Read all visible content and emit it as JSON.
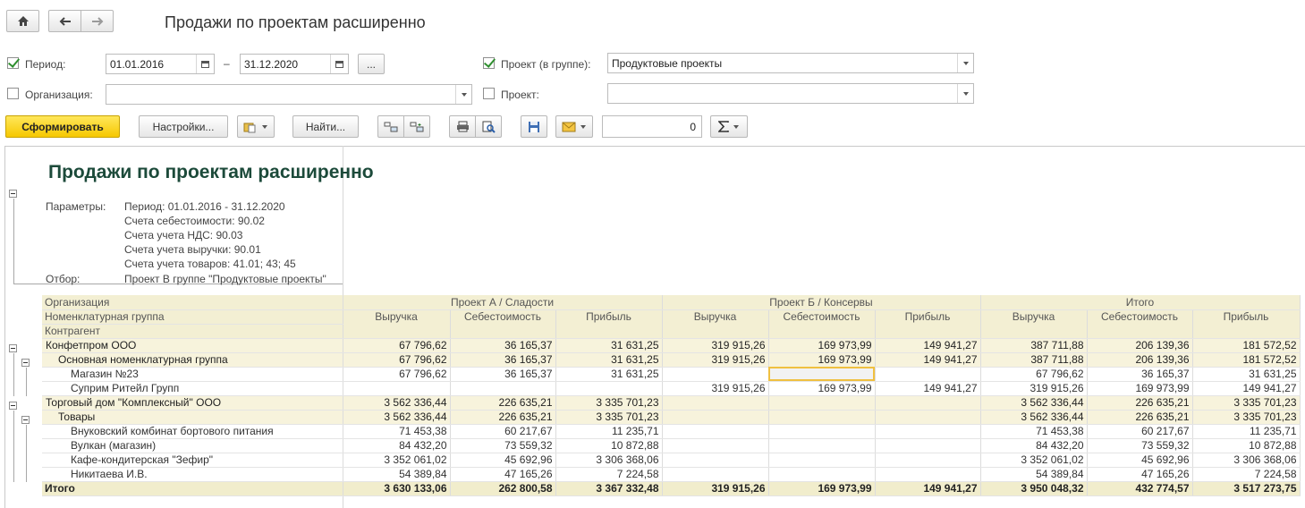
{
  "window": {
    "title": "Продажи по проектам расширенно"
  },
  "filters": {
    "period_label": "Период:",
    "period_from": "01.01.2016",
    "period_dash": "–",
    "period_to": "31.12.2020",
    "period_more": "...",
    "org_label": "Организация:",
    "org_value": "",
    "project_group_label": "Проект (в группе):",
    "project_group_value": "Продуктовые проекты",
    "project_label": "Проект:",
    "project_value": ""
  },
  "toolbar": {
    "generate": "Сформировать",
    "settings": "Настройки...",
    "find": "Найти...",
    "sum_field": "0"
  },
  "report": {
    "title": "Продажи по проектам расширенно",
    "params_label": "Параметры:",
    "params": [
      "Период: 01.01.2016 - 31.12.2020",
      "Счета себестоимости: 90.02",
      "Счета учета НДС: 90.03",
      "Счета учета выручки: 90.01",
      "Счета учета товаров: 41.01; 43; 45"
    ],
    "filter_label": "Отбор:",
    "filter_value": "Проект В группе \"Продуктовые проекты\""
  },
  "table": {
    "row_headers": [
      "Организация",
      "Номенклатурная группа",
      "Контрагент"
    ],
    "groups": [
      "Проект А / Сладости",
      "Проект Б / Консервы",
      "Итого"
    ],
    "columns": [
      "Выручка",
      "Себестоимость",
      "Прибыль",
      "Выручка",
      "Себестоимость",
      "Прибыль",
      "Выручка",
      "Себестоимость",
      "Прибыль"
    ],
    "rows": [
      {
        "level": 0,
        "name": "Конфетпром ООО",
        "values": [
          "67 796,62",
          "36 165,37",
          "31 631,25",
          "319 915,26",
          "169 973,99",
          "149 941,27",
          "387 711,88",
          "206 139,36",
          "181 572,52"
        ]
      },
      {
        "level": 1,
        "name": "Основная номенклатурная группа",
        "values": [
          "67 796,62",
          "36 165,37",
          "31 631,25",
          "319 915,26",
          "169 973,99",
          "149 941,27",
          "387 711,88",
          "206 139,36",
          "181 572,52"
        ]
      },
      {
        "level": 2,
        "name": "Магазин №23",
        "values": [
          "67 796,62",
          "36 165,37",
          "31 631,25",
          "",
          "",
          "",
          "67 796,62",
          "36 165,37",
          "31 631,25"
        ]
      },
      {
        "level": 2,
        "name": "Суприм Ритейл Групп",
        "values": [
          "",
          "",
          "",
          "319 915,26",
          "169 973,99",
          "149 941,27",
          "319 915,26",
          "169 973,99",
          "149 941,27"
        ]
      },
      {
        "level": 0,
        "name": "Торговый дом \"Комплексный\" ООО",
        "values": [
          "3 562 336,44",
          "226 635,21",
          "3 335 701,23",
          "",
          "",
          "",
          "3 562 336,44",
          "226 635,21",
          "3 335 701,23"
        ]
      },
      {
        "level": 1,
        "name": "Товары",
        "values": [
          "3 562 336,44",
          "226 635,21",
          "3 335 701,23",
          "",
          "",
          "",
          "3 562 336,44",
          "226 635,21",
          "3 335 701,23"
        ]
      },
      {
        "level": 2,
        "name": "Внуковский комбинат бортового питания",
        "values": [
          "71 453,38",
          "60 217,67",
          "11 235,71",
          "",
          "",
          "",
          "71 453,38",
          "60 217,67",
          "11 235,71"
        ]
      },
      {
        "level": 2,
        "name": "Вулкан (магазин)",
        "values": [
          "84 432,20",
          "73 559,32",
          "10 872,88",
          "",
          "",
          "",
          "84 432,20",
          "73 559,32",
          "10 872,88"
        ]
      },
      {
        "level": 2,
        "name": "Кафе-кондитерская \"Зефир\"",
        "values": [
          "3 352 061,02",
          "45 692,96",
          "3 306 368,06",
          "",
          "",
          "",
          "3 352 061,02",
          "45 692,96",
          "3 306 368,06"
        ]
      },
      {
        "level": 2,
        "name": "Никитаева И.В.",
        "values": [
          "54 389,84",
          "47 165,26",
          "7 224,58",
          "",
          "",
          "",
          "54 389,84",
          "47 165,26",
          "7 224,58"
        ]
      }
    ],
    "total": {
      "name": "Итого",
      "values": [
        "3 630 133,06",
        "262 800,58",
        "3 367 332,48",
        "319 915,26",
        "169 973,99",
        "149 941,27",
        "3 950 048,32",
        "432 774,57",
        "3 517 273,75"
      ]
    }
  }
}
